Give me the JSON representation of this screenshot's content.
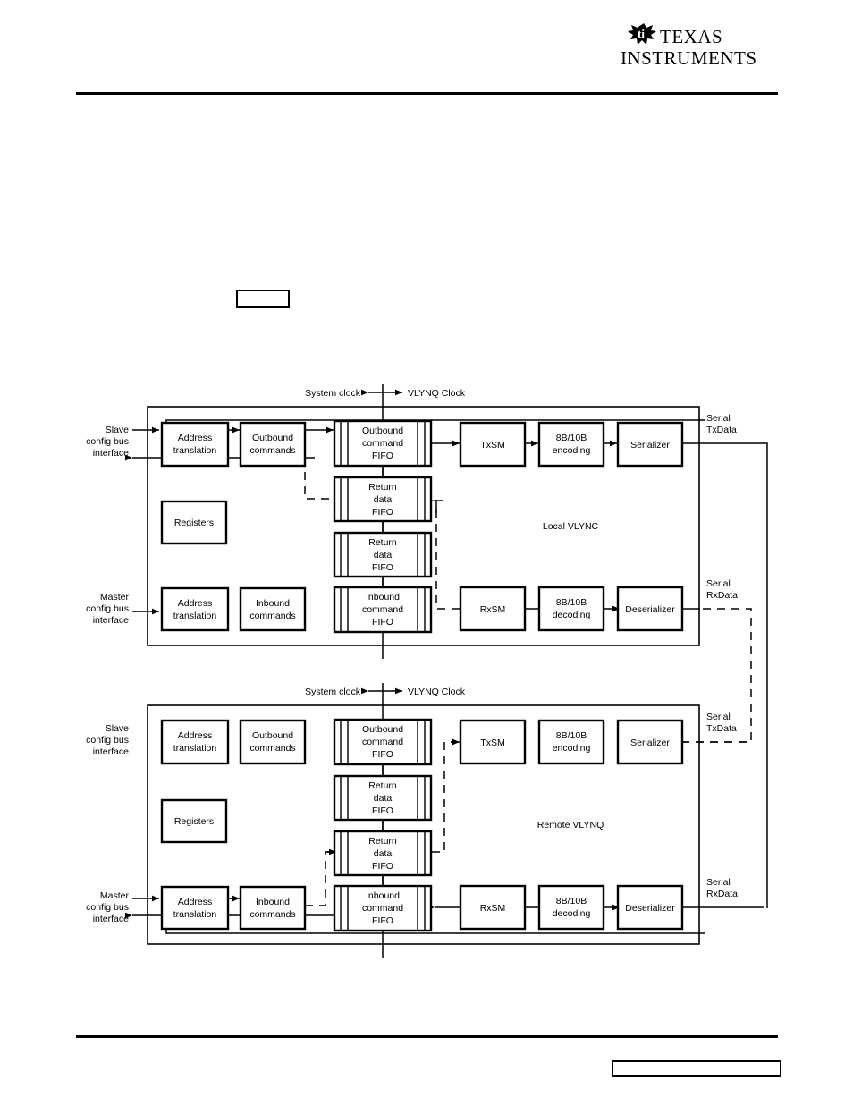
{
  "header": {
    "logo_name": "Texas Instruments",
    "logo_line1": "TEXAS",
    "logo_line2": "INSTRUMENTS"
  },
  "diagrams": [
    {
      "id": "local",
      "title": "Local VLYNC",
      "clock_left": "System clock",
      "clock_right": "VLYNQ Clock",
      "left_ports": [
        {
          "id": "slave",
          "l1": "Slave",
          "l2": "config bus",
          "l3": "interface"
        },
        {
          "id": "master",
          "l1": "Master",
          "l2": "config bus",
          "l3": "interface"
        }
      ],
      "right_ports": [
        {
          "id": "tx",
          "l1": "Serial",
          "l2": "TxData"
        },
        {
          "id": "rx",
          "l1": "Serial",
          "l2": "RxData"
        }
      ],
      "blocks": [
        {
          "id": "addr-top",
          "l1": "Address",
          "l2": "translation",
          "l3": ""
        },
        {
          "id": "outbound-cmd",
          "l1": "Outbound",
          "l2": "commands",
          "l3": ""
        },
        {
          "id": "registers",
          "l1": "Registers",
          "l2": "",
          "l3": ""
        },
        {
          "id": "addr-bot",
          "l1": "Address",
          "l2": "translation",
          "l3": ""
        },
        {
          "id": "inbound-cmd",
          "l1": "Inbound",
          "l2": "commands",
          "l3": ""
        },
        {
          "id": "txsm",
          "l1": "TxSM",
          "l2": "",
          "l3": ""
        },
        {
          "id": "encoding",
          "l1": "8B/10B",
          "l2": "encoding",
          "l3": ""
        },
        {
          "id": "serializer",
          "l1": "Serializer",
          "l2": "",
          "l3": ""
        },
        {
          "id": "rxsm",
          "l1": "RxSM",
          "l2": "",
          "l3": ""
        },
        {
          "id": "decoding",
          "l1": "8B/10B",
          "l2": "decoding",
          "l3": ""
        },
        {
          "id": "deserializer",
          "l1": "Deserializer",
          "l2": "",
          "l3": ""
        }
      ],
      "fifos": [
        {
          "id": "outbound-fifo",
          "l1": "Outbound",
          "l2": "command",
          "l3": "FIFO"
        },
        {
          "id": "return-fifo-1",
          "l1": "Return",
          "l2": "data",
          "l3": "FIFO"
        },
        {
          "id": "return-fifo-2",
          "l1": "Return",
          "l2": "data",
          "l3": "FIFO"
        },
        {
          "id": "inbound-fifo",
          "l1": "Inbound",
          "l2": "command",
          "l3": "FIFO"
        }
      ]
    },
    {
      "id": "remote",
      "title": "Remote VLYNQ",
      "clock_left": "System clock",
      "clock_right": "VLYNQ Clock",
      "left_ports": [
        {
          "id": "slave",
          "l1": "Slave",
          "l2": "config bus",
          "l3": "interface"
        },
        {
          "id": "master",
          "l1": "Master",
          "l2": "config bus",
          "l3": "interface"
        }
      ],
      "right_ports": [
        {
          "id": "tx",
          "l1": "Serial",
          "l2": "TxData"
        },
        {
          "id": "rx",
          "l1": "Serial",
          "l2": "RxData"
        }
      ],
      "blocks": [
        {
          "id": "addr-top",
          "l1": "Address",
          "l2": "translation",
          "l3": ""
        },
        {
          "id": "outbound-cmd",
          "l1": "Outbound",
          "l2": "commands",
          "l3": ""
        },
        {
          "id": "registers",
          "l1": "Registers",
          "l2": "",
          "l3": ""
        },
        {
          "id": "addr-bot",
          "l1": "Address",
          "l2": "translation",
          "l3": ""
        },
        {
          "id": "inbound-cmd",
          "l1": "Inbound",
          "l2": "commands",
          "l3": ""
        },
        {
          "id": "txsm",
          "l1": "TxSM",
          "l2": "",
          "l3": ""
        },
        {
          "id": "encoding",
          "l1": "8B/10B",
          "l2": "encoding",
          "l3": ""
        },
        {
          "id": "serializer",
          "l1": "Serializer",
          "l2": "",
          "l3": ""
        },
        {
          "id": "rxsm",
          "l1": "RxSM",
          "l2": "",
          "l3": ""
        },
        {
          "id": "decoding",
          "l1": "8B/10B",
          "l2": "decoding",
          "l3": ""
        },
        {
          "id": "deserializer",
          "l1": "Deserializer",
          "l2": "",
          "l3": ""
        }
      ],
      "fifos": [
        {
          "id": "outbound-fifo",
          "l1": "Outbound",
          "l2": "command",
          "l3": "FIFO"
        },
        {
          "id": "return-fifo-1",
          "l1": "Return",
          "l2": "data",
          "l3": "FIFO"
        },
        {
          "id": "return-fifo-2",
          "l1": "Return",
          "l2": "data",
          "l3": "FIFO"
        },
        {
          "id": "inbound-fifo",
          "l1": "Inbound",
          "l2": "command",
          "l3": "FIFO"
        }
      ]
    }
  ],
  "colors": {
    "ink": "#000000",
    "paper": "#ffffff"
  }
}
